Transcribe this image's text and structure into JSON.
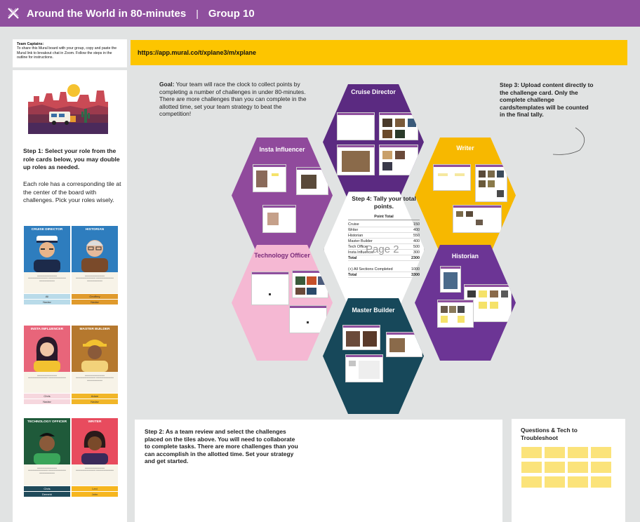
{
  "header": {
    "title": "Around the World in 80-minutes",
    "separator": "|",
    "group": "Group 10"
  },
  "captains": {
    "heading": "Team Captains:",
    "text": "To share this Mural board with your group, copy and paste the Mural link to breakout chat in Zoom. Follow the steps in the outline for instructions."
  },
  "url": "https://app.mural.co/t/xplane3/m/xplane",
  "left": {
    "step1_title": "Step 1: Select your role from the role cards below, you may double up roles as needed.",
    "step1_text": "Each role has a corresponding tile at the center of the board with challenges. Pick your roles wisely."
  },
  "role_cards": [
    {
      "label": "CRUISE DIRECTOR",
      "color": "#2e7dbe",
      "names": [
        "Ali",
        "Nadav"
      ],
      "name_colors": [
        "#b9dbe9",
        "#b9dbe9"
      ]
    },
    {
      "label": "HISTORIAN",
      "color": "#2e7dbe",
      "names": [
        "Geoffrey",
        "Nadav"
      ],
      "name_colors": [
        "#e09a2c",
        "#e09a2c"
      ]
    },
    {
      "label": "INSTA INFLUENCER",
      "color": "#e8657a",
      "names": [
        "Chris",
        "Nadav"
      ],
      "name_colors": [
        "#f6d7de",
        "#f6d7de"
      ]
    },
    {
      "label": "MASTER BUILDER",
      "color": "#b5782e",
      "names": [
        "Adam",
        "Nadav"
      ],
      "name_colors": [
        "#f1b628",
        "#f1b628"
      ]
    },
    {
      "label": "TECHNOLOGY OFFICER",
      "color": "#1f5a3a",
      "names": [
        "Chris",
        "Demetri"
      ],
      "name_colors": [
        "#1f4a5a",
        "#1f4a5a"
      ]
    },
    {
      "label": "WRITER",
      "color": "#e84b5e",
      "names": [
        "Lexi",
        "John"
      ],
      "name_colors": [
        "#f6b61f",
        "#f6b61f"
      ]
    }
  ],
  "goal": {
    "label": "Goal:",
    "text": "Your team will race the clock to collect points by completing a number of challenges in under 80-minutes. There are more challenges than you can complete in the allotted time, set your team strategy to beat the competition!"
  },
  "step3": "Step 3: Upload content directly to the challenge card. Only the complete challenge cards/templates will be counted in the final tally.",
  "hexes": {
    "cruise": "Cruise Director",
    "writer": "Writer",
    "insta": "Insta Influencer",
    "tech": "Technology Officer",
    "historian": "Historian",
    "builder": "Master Builder"
  },
  "hex_colors": {
    "cruise": "#5b2a81",
    "writer": "#f7b800",
    "insta": "#904a9c",
    "tech": "#f5b8d3",
    "historian": "#6c3595",
    "builder": "#17485a"
  },
  "tally": {
    "title": "Step 4: Tally your total points.",
    "header": "Point Total",
    "rows": [
      {
        "label": "Cruise",
        "value": "150"
      },
      {
        "label": "Writer",
        "value": "400"
      },
      {
        "label": "Historian",
        "value": "550"
      },
      {
        "label": "Master Builder",
        "value": "400"
      },
      {
        "label": "Tech Officer",
        "value": "500"
      },
      {
        "label": "Insta Influencer",
        "value": "300"
      },
      {
        "label": "Total",
        "value": "2300",
        "bold": true
      }
    ],
    "bonus_rows": [
      {
        "label": "(+) All Sections Completed",
        "value": "1000"
      },
      {
        "label": "Total",
        "value": "3300",
        "bold": true
      }
    ],
    "watermark": "Page 2"
  },
  "step2": "Step 2: As a team review and select the challenges placed on the tiles above. You will need to collaborate to complete tasks. There are more challenges than you can accomplish in the allotted time. Set your strategy and get started.",
  "questions_title": "Questions & Tech to Troubleshoot",
  "icons": {
    "logo": "xplane-logo-icon"
  }
}
